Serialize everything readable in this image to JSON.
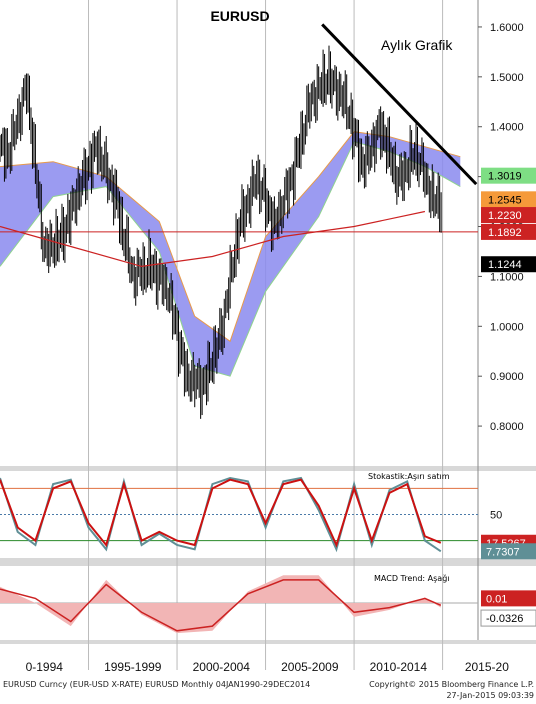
{
  "chart_data": [
    {
      "type": "line",
      "title": "EURUSD",
      "subtitle": "Aylık Grafik",
      "yticks": [
        "1.6000",
        "1.5000",
        "1.4000",
        "1.3000",
        "1.2000",
        "1.1000",
        "1.0000",
        "0.9000",
        "0.8000"
      ],
      "ylim": [
        0.72,
        1.65
      ],
      "xrange": [
        1990.0,
        2017.0
      ],
      "series": [
        {
          "type": "candlestick",
          "color": "#000000",
          "x": [
            1990.5,
            1991.5,
            1992.5,
            1993.5,
            1994.5,
            1995.5,
            1996.5,
            1997.5,
            1998.5,
            1999.5,
            2000.5,
            2001.5,
            2002.5,
            2003.5,
            2004.5,
            2005.5,
            2006.5,
            2007.5,
            2008.5,
            2009.5,
            2010.5,
            2011.5,
            2012.5,
            2013.5,
            2014.5
          ],
          "y": [
            1.35,
            1.48,
            1.15,
            1.18,
            1.28,
            1.36,
            1.26,
            1.1,
            1.12,
            1.07,
            0.9,
            0.88,
            0.99,
            1.2,
            1.3,
            1.2,
            1.3,
            1.45,
            1.5,
            1.45,
            1.32,
            1.4,
            1.29,
            1.35,
            1.25
          ]
        },
        {
          "type": "line",
          "color": "#cc2222",
          "x": [
            1990.0,
            1994.0,
            1998.0,
            2002.0,
            2006.0,
            2010.0,
            2014.0
          ],
          "y": [
            1.2,
            1.16,
            1.12,
            1.14,
            1.18,
            1.2,
            1.23
          ]
        }
      ],
      "ichimoku_cloud": {
        "upper": {
          "x": [
            1990.0,
            1993.0,
            1996.0,
            1999.0,
            2001.0,
            2003.0,
            2005.0,
            2008.0,
            2010.0,
            2012.0,
            2014.0,
            2016.0
          ],
          "y": [
            1.32,
            1.33,
            1.3,
            1.21,
            1.02,
            0.97,
            1.18,
            1.3,
            1.39,
            1.38,
            1.36,
            1.34
          ]
        },
        "lower": {
          "x": [
            1990.0,
            1993.0,
            1996.0,
            1999.0,
            2001.0,
            2003.0,
            2005.0,
            2008.0,
            2010.0,
            2012.0,
            2014.0,
            2016.0
          ],
          "y": [
            1.12,
            1.26,
            1.28,
            1.15,
            0.92,
            0.9,
            1.07,
            1.22,
            1.37,
            1.35,
            1.32,
            1.28
          ]
        },
        "fill_color": "#8a8aef"
      },
      "trendline": {
        "color": "#000000",
        "x": [
          2008.2,
          2016.9
        ],
        "y": [
          1.605,
          1.285
        ]
      },
      "horizontal_line": {
        "color": "#cc2222",
        "y": 1.1892
      },
      "price_labels": [
        {
          "text": "1.3019",
          "y": 1.3019,
          "bg": "#7ede84",
          "color": "#000000"
        },
        {
          "text": "1.2545",
          "y": 1.2545,
          "bg": "#f59a3a",
          "color": "#000000"
        },
        {
          "text": "1.2230",
          "y": 1.223,
          "bg": "#cc2222",
          "color": "#ffffff"
        },
        {
          "text": "1.1892",
          "y": 1.1892,
          "bg": "#cc2222",
          "color": "#ffffff"
        },
        {
          "text": "1.1244",
          "y": 1.1244,
          "bg": "#000000",
          "color": "#ffffff"
        }
      ]
    },
    {
      "type": "line",
      "title": "Stokastik:Aşırı satım",
      "yticks": [
        "50"
      ],
      "ylim": [
        0,
        100
      ],
      "levels": [
        {
          "y": 80,
          "color": "#e07040"
        },
        {
          "y": 50,
          "color": "#4a7aa8"
        },
        {
          "y": 20,
          "color": "#2a8a2a"
        }
      ],
      "series": [
        {
          "type": "line",
          "color": "#cc1111",
          "x": [
            1990.0,
            1991.0,
            1992.0,
            1993.0,
            1994.0,
            1995.0,
            1996.0,
            1997.0,
            1998.0,
            1999.0,
            2000.0,
            2001.0,
            2002.0,
            2003.0,
            2004.0,
            2005.0,
            2006.0,
            2007.0,
            2008.0,
            2009.0,
            2010.0,
            2011.0,
            2012.0,
            2013.0,
            2014.0,
            2014.9
          ],
          "y": [
            90,
            35,
            20,
            80,
            88,
            40,
            15,
            85,
            20,
            30,
            20,
            15,
            80,
            90,
            85,
            40,
            85,
            90,
            60,
            15,
            80,
            20,
            75,
            85,
            25,
            17.5
          ]
        },
        {
          "type": "line",
          "color": "#5f8f96",
          "x": [
            1990.0,
            1991.0,
            1992.0,
            1993.0,
            1994.0,
            1995.0,
            1996.0,
            1997.0,
            1998.0,
            1999.0,
            2000.0,
            2001.0,
            2002.0,
            2003.0,
            2004.0,
            2005.0,
            2006.0,
            2007.0,
            2008.0,
            2009.0,
            2010.0,
            2011.0,
            2012.0,
            2013.0,
            2014.0,
            2014.9
          ],
          "y": [
            92,
            30,
            15,
            85,
            90,
            35,
            10,
            88,
            15,
            28,
            15,
            10,
            85,
            92,
            88,
            35,
            88,
            92,
            55,
            10,
            85,
            15,
            78,
            88,
            20,
            7.7
          ]
        }
      ],
      "value_labels": [
        {
          "text": "17.5267",
          "y": 17.5267,
          "bg": "#cc2222",
          "color": "#ffffff"
        },
        {
          "text": "7.7307",
          "y": 7.7307,
          "bg": "#5f8f96",
          "color": "#ffffff"
        }
      ]
    },
    {
      "type": "area",
      "title": "MACD Trend: Aşağı",
      "ylim": [
        -0.08,
        0.08
      ],
      "series": [
        {
          "type": "line",
          "color": "#cc2222",
          "x": [
            1990.0,
            1992.0,
            1994.0,
            1996.0,
            1998.0,
            2000.0,
            2002.0,
            2004.0,
            2006.0,
            2008.0,
            2010.0,
            2012.0,
            2014.0,
            2014.9
          ],
          "y": [
            0.03,
            0.01,
            -0.04,
            0.04,
            -0.02,
            -0.06,
            -0.05,
            0.02,
            0.05,
            0.05,
            -0.02,
            -0.01,
            0.01,
            -0.005
          ]
        },
        {
          "type": "area",
          "color": "#f2b5b5",
          "x": [
            1990.0,
            1992.0,
            1994.0,
            1996.0,
            1998.0,
            2000.0,
            2002.0,
            2004.0,
            2006.0,
            2008.0,
            2010.0,
            2012.0,
            2014.0,
            2014.9
          ],
          "y": [
            0.035,
            0.0,
            -0.05,
            0.05,
            -0.025,
            -0.065,
            -0.06,
            0.025,
            0.06,
            0.06,
            -0.03,
            -0.015,
            0.012,
            -0.01
          ]
        }
      ],
      "value_labels": [
        {
          "text": "0.01",
          "y": 0.01,
          "bg": "#cc2222",
          "color": "#ffffff"
        },
        {
          "text": "-0.0326",
          "y": -0.0326,
          "bg": "#ffffff",
          "color": "#000000"
        }
      ]
    }
  ],
  "x_axis": {
    "labels": [
      "0-1994",
      "1995-1999",
      "2000-2004",
      "2005-2009",
      "2010-2014",
      "2015-20"
    ],
    "periods": [
      [
        1990,
        1995
      ],
      [
        1995,
        2000
      ],
      [
        2000,
        2005
      ],
      [
        2005,
        2010
      ],
      [
        2010,
        2015
      ],
      [
        2015,
        2020
      ]
    ]
  },
  "footer": {
    "left": "EURUSD Curncy (EUR-USD X-RATE) EURUSD  Monthly 04JAN1990-29DEC2014",
    "right_line1": "Copyright© 2015 Bloomberg Finance L.P.",
    "right_line2": "27-Jan-2015 09:03:39"
  }
}
